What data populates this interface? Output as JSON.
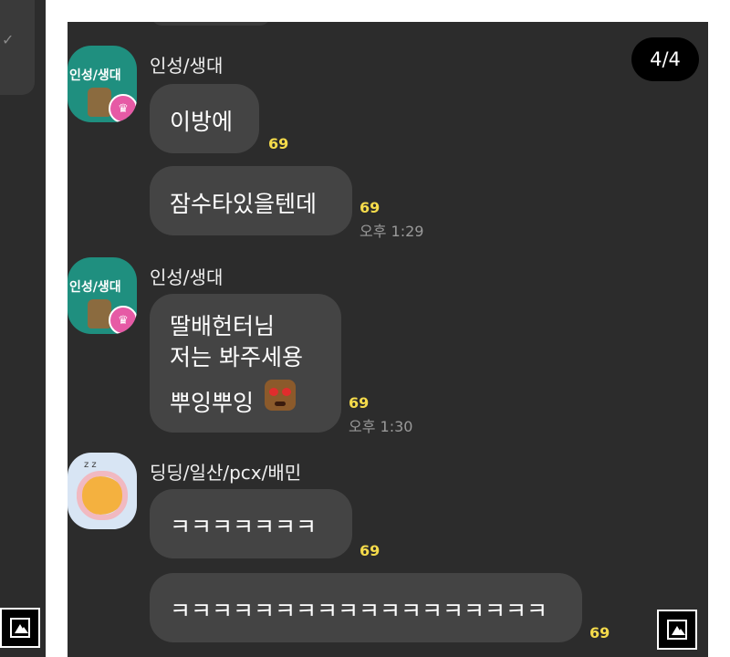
{
  "counter": "4/4",
  "messages": [
    {
      "sender": "인성/생대",
      "avatar_label": "인성/생대",
      "bubbles": [
        {
          "text": "이방에",
          "unread": "69"
        },
        {
          "text": "잠수타있을텐데",
          "unread": "69",
          "time": "오후 1:29"
        }
      ]
    },
    {
      "sender": "인성/생대",
      "avatar_label": "인성/생대",
      "bubbles": [
        {
          "lines": [
            "딸배헌터님",
            "저는 봐주세용",
            "뿌잉뿌잉"
          ],
          "unread": "69",
          "time": "오후 1:30"
        }
      ]
    },
    {
      "sender": "딩딩/일산/pcx/배민",
      "avatar_label": "z z",
      "bubbles": [
        {
          "text": "ㅋㅋㅋㅋㅋㅋㅋ",
          "unread": "69"
        },
        {
          "text": "ㅋㅋㅋㅋㅋㅋㅋㅋㅋㅋㅋㅋㅋㅋㅋㅋㅋㅋ",
          "unread": "69"
        }
      ]
    }
  ],
  "icons": {
    "check": "check-icon",
    "crown": "crown-icon",
    "image": "image-icon"
  }
}
